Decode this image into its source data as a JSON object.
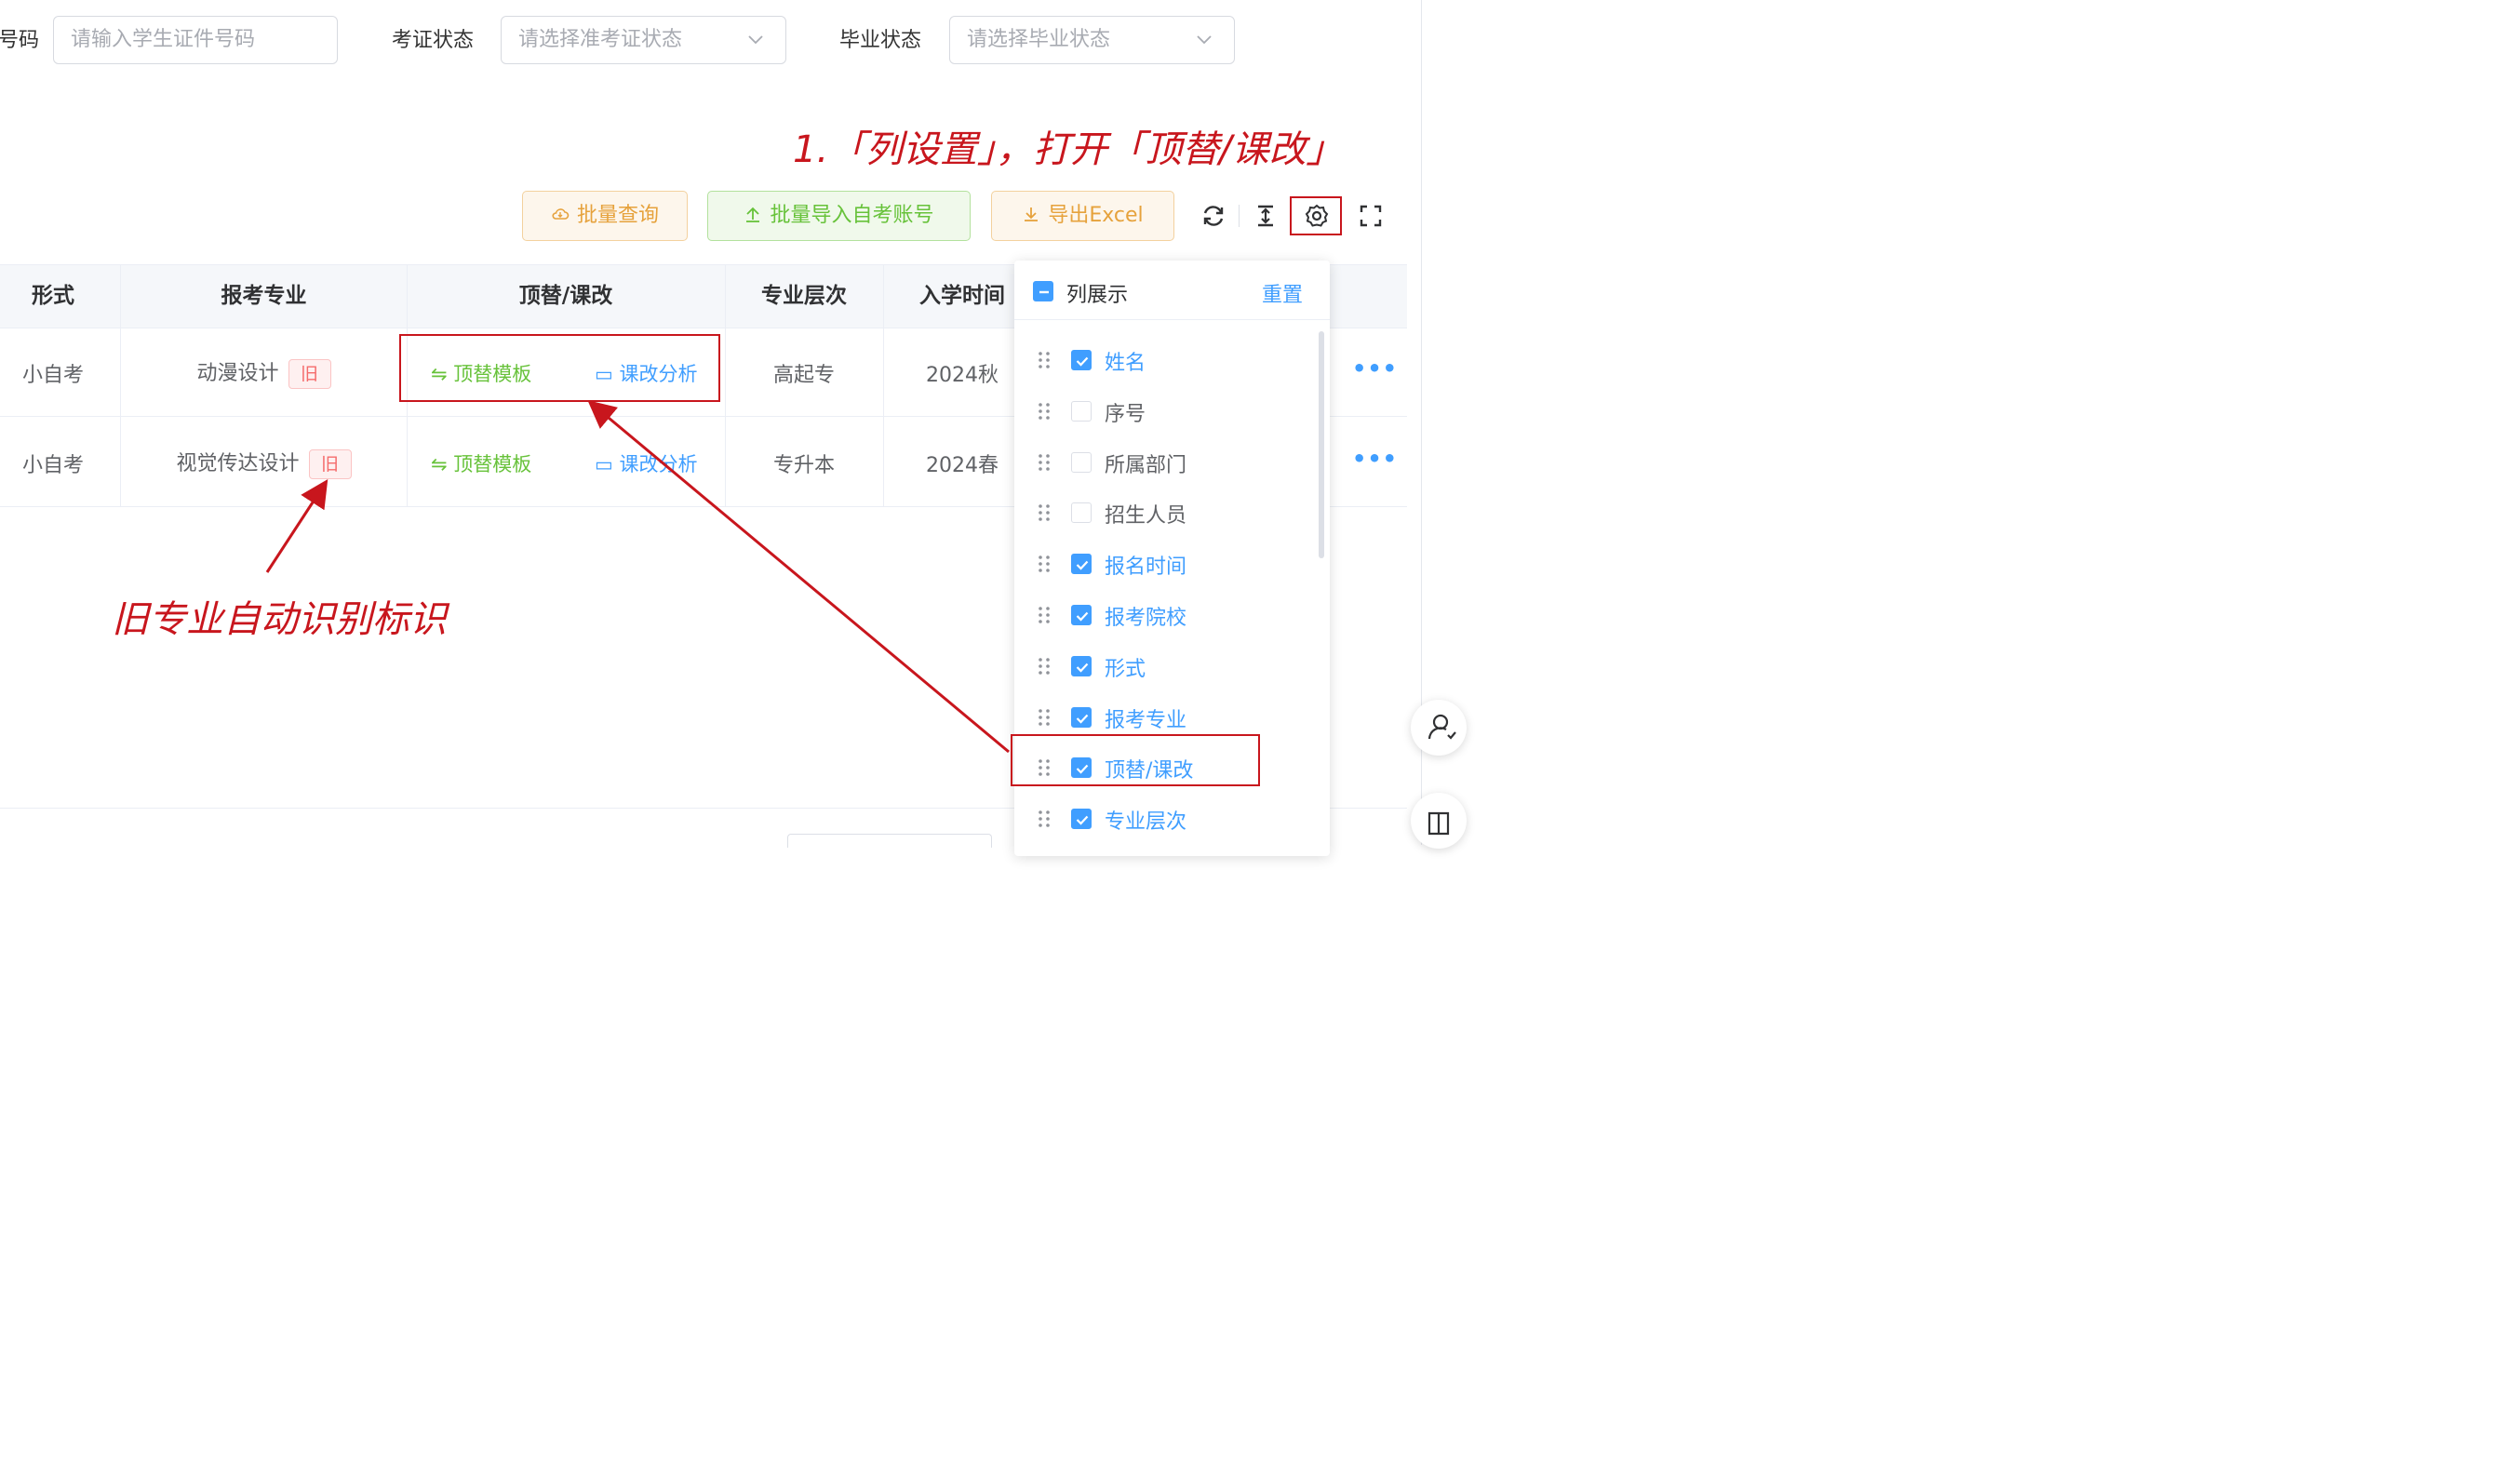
{
  "filters": {
    "id_label": "号码",
    "id_placeholder": "请输入学生证件号码",
    "exam_status_label": "考证状态",
    "exam_status_placeholder": "请选择准考证状态",
    "grad_status_label": "毕业状态",
    "grad_status_placeholder": "请选择毕业状态"
  },
  "annotations": {
    "step1": "1.「列设置」，打开「顶替/课改」",
    "old_major": "旧专业自动识别标识"
  },
  "toolbar": {
    "batch_query": "批量查询",
    "batch_import": "批量导入自考账号",
    "export": "导出Excel",
    "icons": [
      "refresh-icon",
      "density-icon",
      "column-settings-icon",
      "fullscreen-icon"
    ]
  },
  "table": {
    "headers": [
      "形式",
      "报考专业",
      "顶替/课改",
      "专业层次",
      "入学时间"
    ],
    "old_tag": "旧",
    "replace_link": "顶替模板",
    "analysis_link": "课改分析",
    "more": "•••",
    "rows": [
      {
        "form": "小自考",
        "major": "动漫设计",
        "level": "高起专",
        "enroll": "2024秋"
      },
      {
        "form": "小自考",
        "major": "视觉传达设计",
        "level": "专升本",
        "enroll": "2024春"
      }
    ]
  },
  "column_settings": {
    "title": "列展示",
    "reset": "重置",
    "columns": [
      {
        "label": "姓名",
        "checked": true
      },
      {
        "label": "序号",
        "checked": false
      },
      {
        "label": "所属部门",
        "checked": false
      },
      {
        "label": "招生人员",
        "checked": false
      },
      {
        "label": "报名时间",
        "checked": true
      },
      {
        "label": "报考院校",
        "checked": true
      },
      {
        "label": "形式",
        "checked": true
      },
      {
        "label": "报考专业",
        "checked": true
      },
      {
        "label": "顶替/课改",
        "checked": true
      },
      {
        "label": "专业层次",
        "checked": true
      }
    ]
  },
  "colors": {
    "primary": "#409eff",
    "warning": "#e6a23c",
    "success": "#67c23a",
    "danger": "#f56c6c",
    "annotation_red": "#c8161d"
  }
}
